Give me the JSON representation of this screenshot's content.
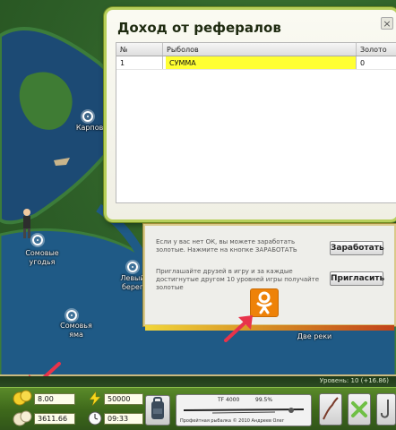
{
  "map": {
    "locations": [
      {
        "label": "Карповое"
      },
      {
        "label": "Сомовые\nугодья"
      },
      {
        "label": "Левый\nберег"
      },
      {
        "label": "Сомовья\nяма"
      },
      {
        "label": "Две реки"
      }
    ]
  },
  "dialog": {
    "title": "Доход от рефералов",
    "close": "×",
    "columns": {
      "num": "№",
      "fisher": "Рыболов",
      "gold": "Золото"
    },
    "rows": [
      {
        "num": "1",
        "fisher": "СУММА",
        "gold": "0"
      }
    ]
  },
  "promo": {
    "earn_text": "Если у вас нет ОК, вы можете заработать золотые. Нажмите на кнопке ЗАРАБОТАТЬ",
    "earn_button": "Заработать",
    "invite_text": "Приглашайте друзей в игру и за каждые достигнутые другом 10 уровней игры получайте золотые",
    "invite_button": "Пригласить",
    "ok_icon": "odnoklassniki-icon"
  },
  "status": {
    "level": "Уровень: 10 (+16.86)"
  },
  "hud": {
    "gold": "8.00",
    "energy": "50000",
    "silver": "3611.66",
    "time": "09:33",
    "rod_name": "TF 4000",
    "rod_condition": "99.5%",
    "copyright": "Профейтная рыбалка ©  2010 Андреев Олег"
  },
  "colors": {
    "accent_green": "#b6cf5a",
    "highlight_yellow": "#ffff33",
    "ok_orange": "#ee8208",
    "arrow_red": "#e8334a"
  }
}
